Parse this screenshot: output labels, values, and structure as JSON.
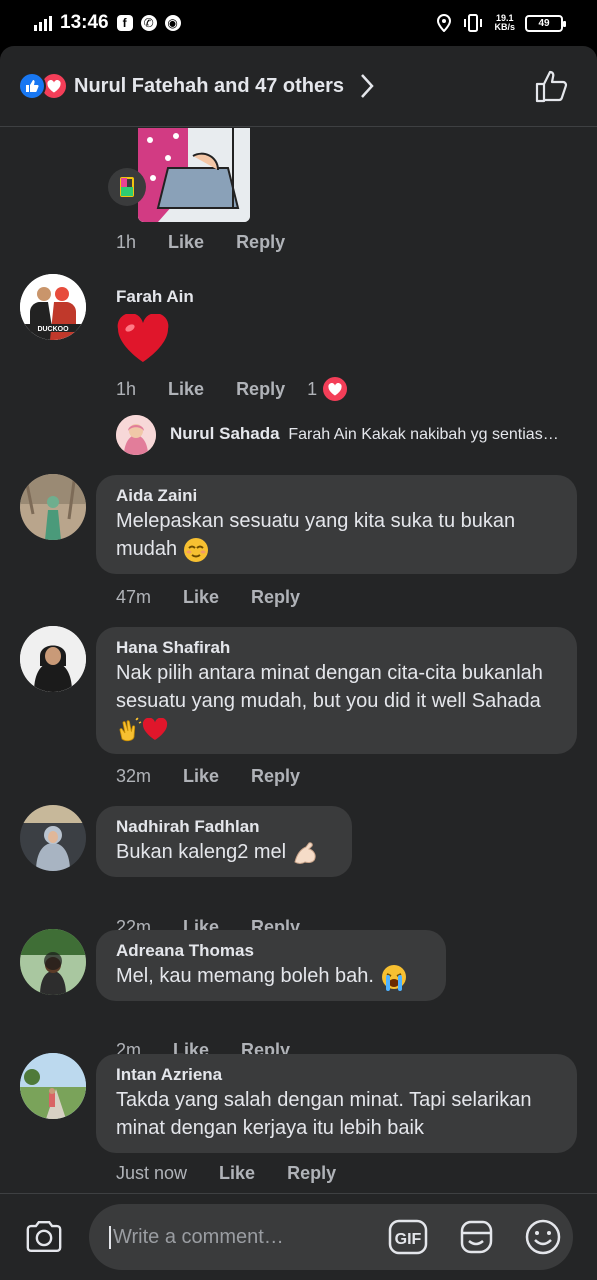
{
  "status_bar": {
    "time": "13:46",
    "battery": "49",
    "net_speed_value": "19.1",
    "net_speed_unit": "KB/s"
  },
  "reactions": {
    "summary": "Nurul Fatehah and 47 others"
  },
  "comments": [
    {
      "time": "1h",
      "like": "Like",
      "reply": "Reply"
    },
    {
      "name": "Farah Ain",
      "time": "1h",
      "like": "Like",
      "reply": "Reply",
      "reaction_count": "1"
    },
    {
      "reply_name": "Nurul Sahada",
      "reply_text": "Farah Ain Kakak nakibah yg sentias…"
    },
    {
      "name": "Aida Zaini",
      "text": "Melepaskan sesuatu yang kita suka tu bukan mudah",
      "time": "47m",
      "like": "Like",
      "reply": "Reply"
    },
    {
      "name": "Hana Shafirah",
      "text": "Nak pilih antara minat dengan cita-cita bukanlah sesuatu yang mudah, but you did it well Sahada",
      "time": "32m",
      "like": "Like",
      "reply": "Reply"
    },
    {
      "name": "Nadhirah Fadhlan",
      "text": "Bukan kaleng2 mel",
      "time": "22m",
      "like": "Like",
      "reply": "Reply"
    },
    {
      "name": "Adreana Thomas",
      "text": "Mel, kau memang boleh bah.",
      "time": "2m",
      "like": "Like",
      "reply": "Reply"
    },
    {
      "name": "Intan Azriena",
      "text": "Takda yang salah dengan minat. Tapi selarikan minat dengan kerjaya itu lebih baik",
      "time": "Just now",
      "like": "Like",
      "reply": "Reply"
    }
  ],
  "avatar_text": "DUCKOO",
  "composer": {
    "placeholder": "Write a comment…",
    "gif_label": "GIF"
  },
  "colors": {
    "sheet_bg": "#242526",
    "bubble_bg": "#3a3b3c",
    "like_blue": "#1877f2",
    "love_red": "#f33e58"
  }
}
